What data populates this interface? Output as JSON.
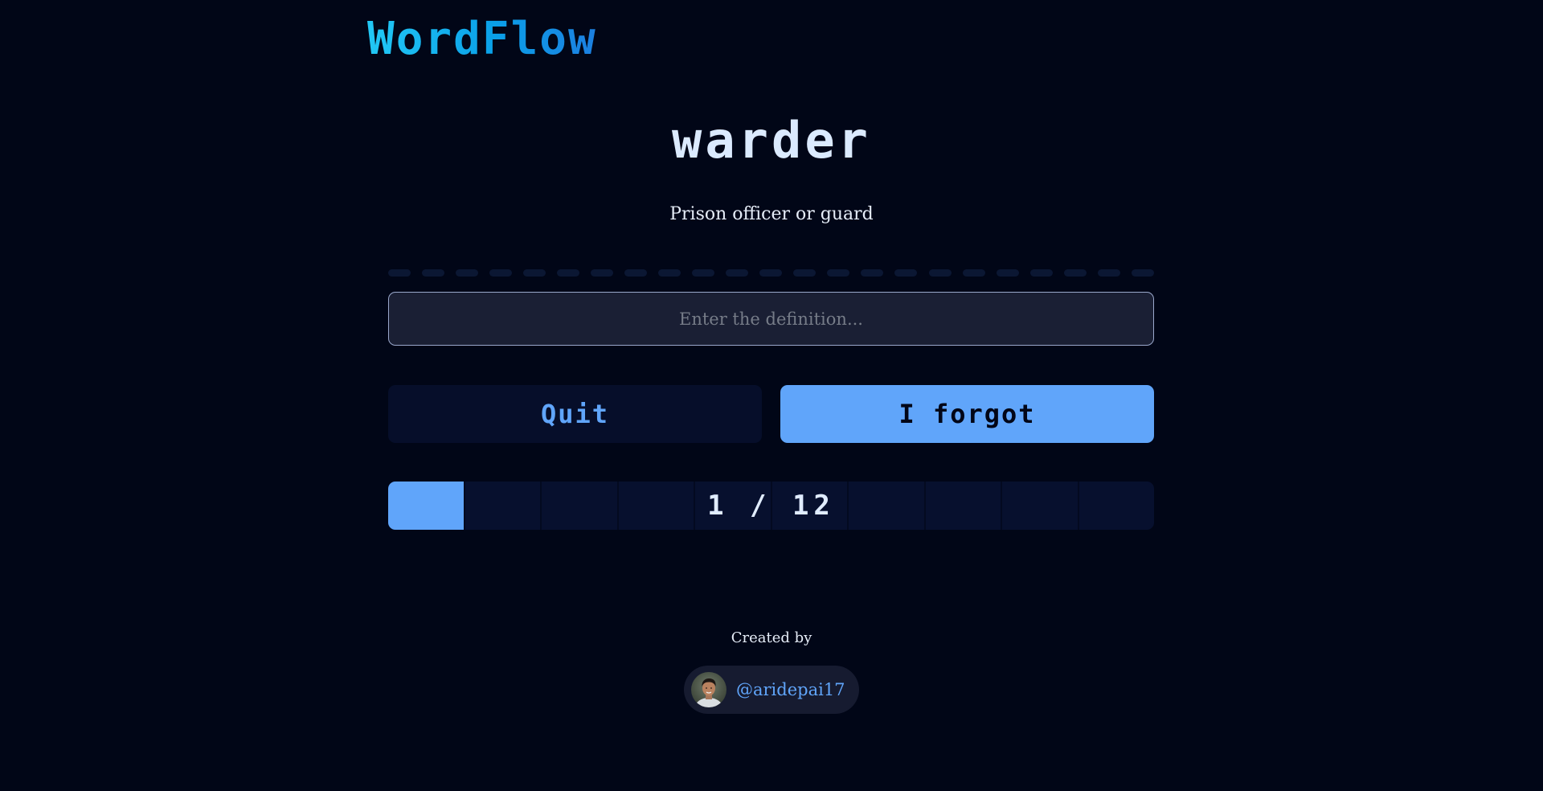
{
  "app": {
    "logo_text": "WordFlow"
  },
  "quiz": {
    "word": "warder",
    "definition": "Prison officer or guard",
    "input_placeholder": "Enter the definition...",
    "quit_label": "Quit",
    "forgot_label": "I forgot",
    "progress": {
      "current": 1,
      "total": 12,
      "label": "1 / 12"
    }
  },
  "footer": {
    "created_by_label": "Created by",
    "author_handle": "@aridepai17",
    "avatar_icon": "user-avatar-photo"
  },
  "colors": {
    "background": "#010617",
    "accent": "#60a5fa",
    "logo_gradient_start": "#22c8f5",
    "logo_gradient_end": "#1c7fe0"
  }
}
